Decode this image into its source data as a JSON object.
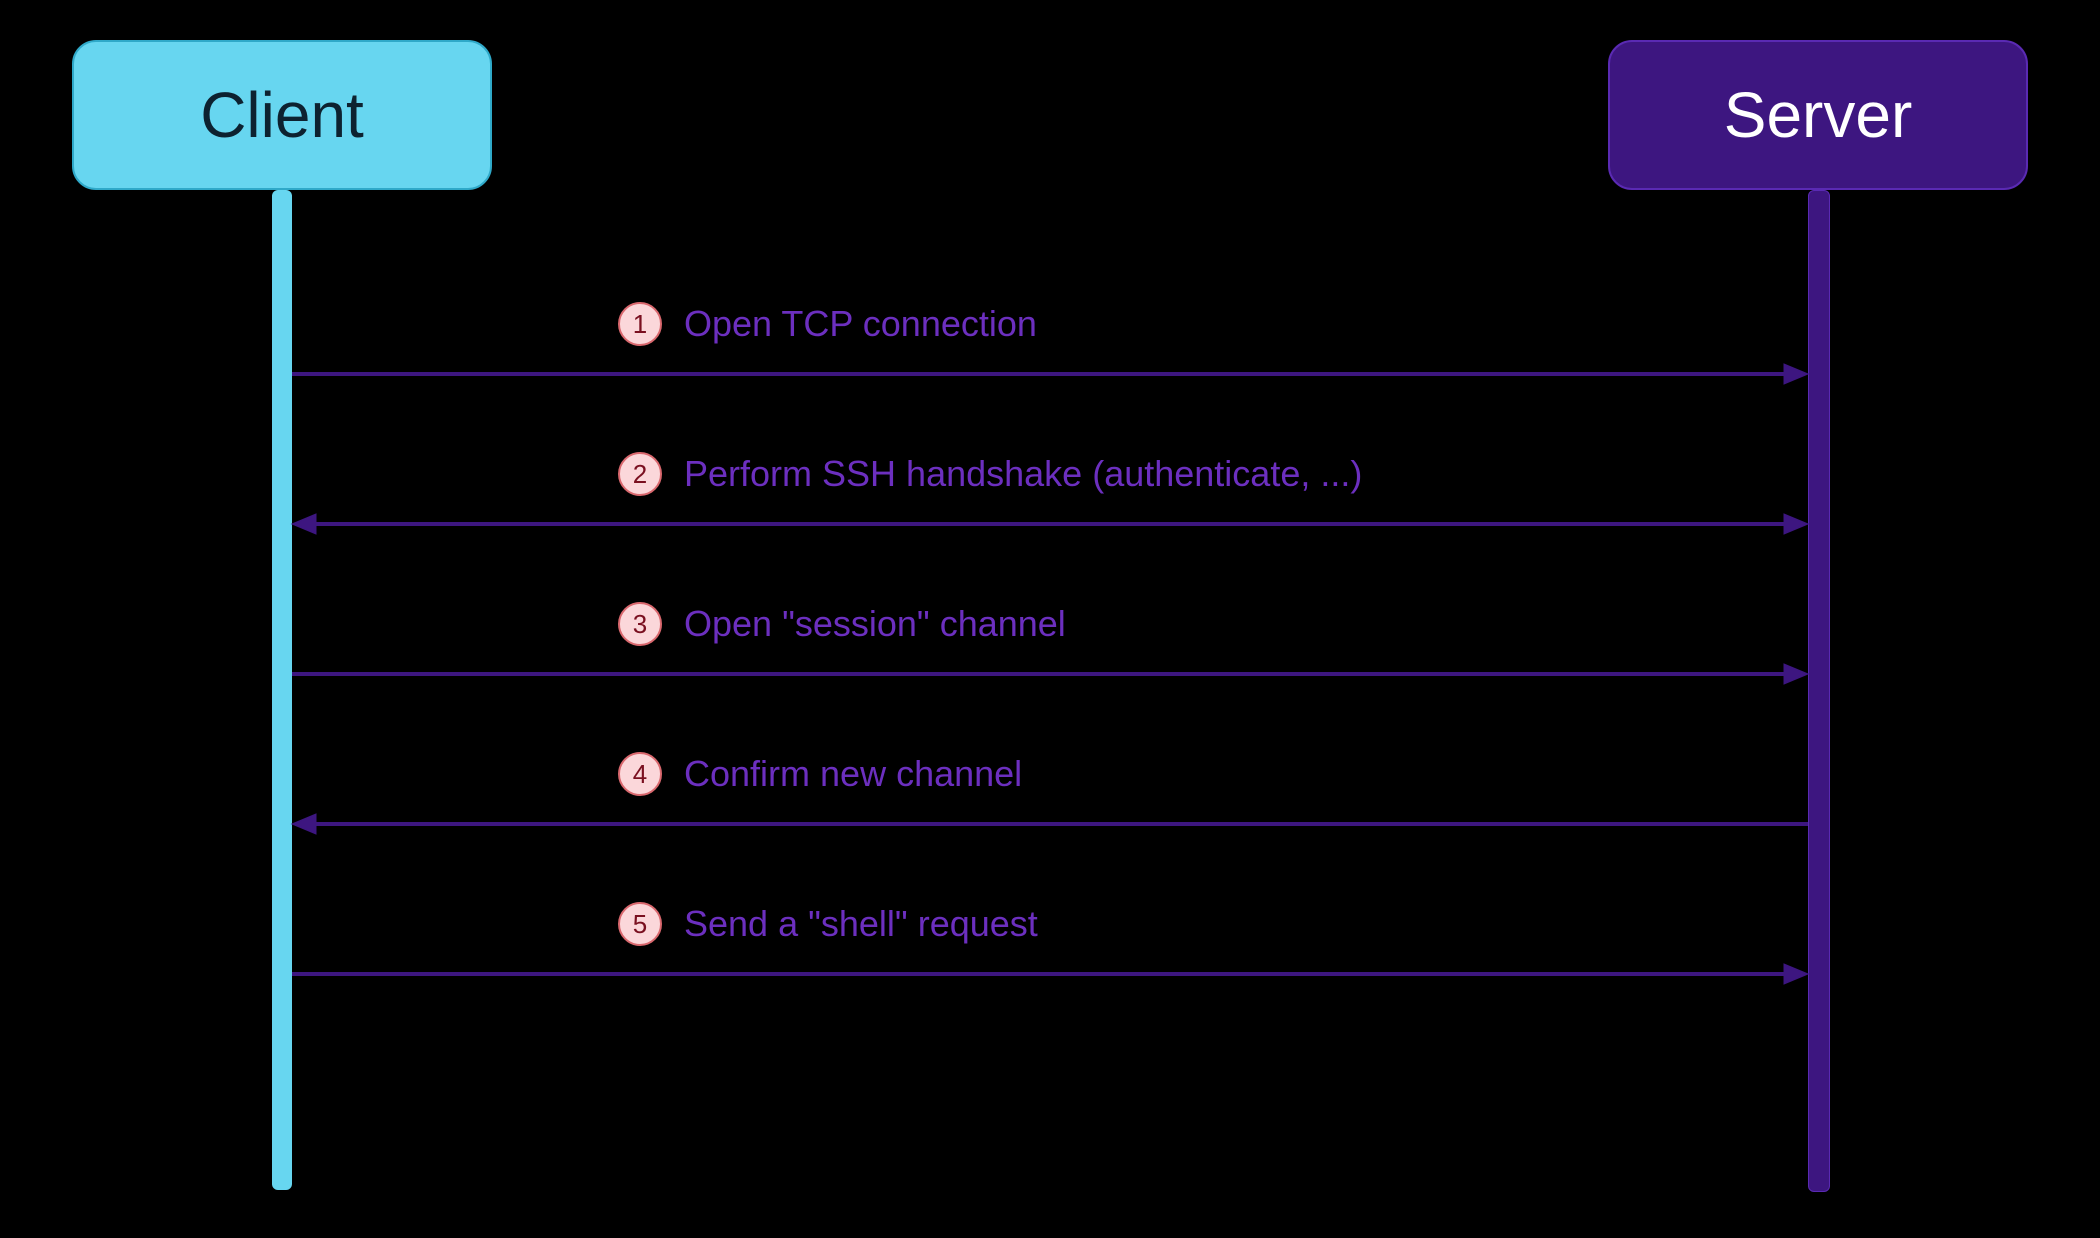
{
  "diagram": {
    "type": "sequence",
    "participants": {
      "client": {
        "label": "Client",
        "color": "#67d6f0",
        "text_color": "#0d2230"
      },
      "server": {
        "label": "Server",
        "color": "#3d1680",
        "text_color": "#ffffff"
      }
    },
    "messages": [
      {
        "num": "1",
        "label": "Open TCP connection",
        "from": "client",
        "to": "server",
        "bidirectional": false
      },
      {
        "num": "2",
        "label": "Perform SSH handshake (authenticate, ...)",
        "from": "client",
        "to": "server",
        "bidirectional": true
      },
      {
        "num": "3",
        "label": "Open \"session\" channel",
        "from": "client",
        "to": "server",
        "bidirectional": false
      },
      {
        "num": "4",
        "label": "Confirm new channel",
        "from": "server",
        "to": "client",
        "bidirectional": false
      },
      {
        "num": "5",
        "label": "Send a \"shell\" request",
        "from": "client",
        "to": "server",
        "bidirectional": false
      }
    ]
  }
}
